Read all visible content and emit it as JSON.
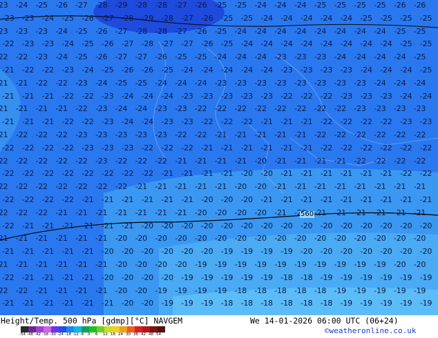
{
  "map": {
    "title": "Height/Temp. 500 hPa [gdmp][°C] NAVGEM",
    "valid_time": "We 14-01-2026 06:00 UTC (06+24)",
    "credit": "©weatheronline.co.uk",
    "contour_labels": [
      "560"
    ],
    "legend": {
      "ticks": [
        "-54",
        "-48",
        "-42",
        "-38",
        "-30",
        "-24",
        "-18",
        "-12",
        "-6",
        "0",
        "6",
        "12",
        "18",
        "24",
        "30",
        "36",
        "42",
        "48",
        "54"
      ],
      "colors": [
        "#2a2a2a",
        "#6a2a8a",
        "#a040d0",
        "#d060f0",
        "#6a38e8",
        "#2050e8",
        "#1888f0",
        "#10b8e8",
        "#10a060",
        "#20c020",
        "#70d020",
        "#c8e020",
        "#f0d020",
        "#f0a020",
        "#e86020",
        "#d82020",
        "#b01818",
        "#801010",
        "#501010"
      ]
    },
    "grid_rows": [
      "-23 -24 -25 -26 -27 -28 -29 -28 -28 -27 -26 -25 -25 -24 -24 -24 -25 -25 -25 -25 -26 -26",
      "-23 -23 -24 -25 -26 -27 -28 -29 -28 -27 -26 -25 -25 -24 -24 -24 -24 -24 -25 -25 -25 -25",
      "-23 -23 -23 -24 -25 -26 -27 -28 -28 -27 -26 -25 -24 -24 -24 -24 -24 -24 -24 -24 -25 -25",
      "-22 -23 -23 -24 -25 -26 -27 -28 -27 -27 -26 -25 -24 -24 -24 -24 -24 -24 -24 -24 -25 -25",
      "-22 -22 -23 -24 -25 -26 -27 -27 -26 -25 -25 -24 -24 -24 -23 -23 -23 -24 -24 -24 -24 -25",
      "-21 -22 -22 -23 -24 -25 -26 -26 -25 -24 -24 -24 -24 -24 -23 -23 -23 -23 -24 -24 -24 -25",
      "-21 -21 -22 -22 -23 -24 -25 -25 -24 -24 -24 -23 -23 -23 -23 -23 -23 -23 -23 -24 -24 -24",
      "-21 -21 -21 -22 -22 -23 -24 -24 -24 -23 -23 -23 -23 -23 -22 -22 -22 -23 -23 -23 -24 -24",
      "-21 -21 -21 -21 -22 -23 -24 -24 -23 -23 -22 -22 -22 -22 -22 -22 -22 -22 -23 -23 -23 -23",
      "-21 -21 -21 -22 -22 -23 -24 -24 -23 -23 -22 -22 -22 -21 -21 -21 -22 -22 -22 -22 -23 -23",
      "-21 -22 -22 -22 -23 -23 -23 -23 -23 -22 -22 -21 -21 -21 -21 -21 -22 -22 -22 -22 -22 -22",
      "-22 -22 -22 -22 -23 -23 -23 -22 -22 -22 -21 -21 -21 -21 -21 -21 -22 -22 -22 -22 -22 -22",
      "-22 -22 -22 -22 -22 -23 -22 -22 -22 -21 -21 -21 -21 -20 -21 -21 -21 -21 -22 -22 -22 -22",
      "-22 -22 -22 -22 -22 -22 -22 -22 -21 -21 -21 -21 -20 -20 -21 -21 -21 -21 -21 -21 -22 -22",
      "-22 -22 -22 -22 -22 -22 -22 -21 -21 -21 -21 -21 -20 -20 -21 -21 -21 -21 -21 -21 -21 -21",
      "-22 -22 -22 -22 -21 -21 -21 -21 -21 -21 -20 -20 -20 -21 -21 -21 -21 -21 -21 -21 -21 -21",
      "-22 -22 -22 -21 -21 -21 -21 -21 -21 -21 -20 -20 -20 -20 -21 -20 -21 -21 -21 -21 -21 -21",
      "-22 -21 -21 -21 -21 -21 -21 -20 -20 -20 -20 -20 -20 -20 -20 -20 -20 -20 -20 -20 -20 -20",
      "-21 -21 -21 -21 -21 -21 -20 -20 -20 -20 -20 -20 -20 -20 -20 -20 -20 -20 -20 -20 -20 -20",
      "-21 -21 -21 -21 -21 -20 -20 -20 -20 -20 -20 -19 -19 -19 -19 -20 -20 -20 -20 -20 -20 -20",
      "-21 -21 -21 -21 -21 -21 -20 -20 -20 -20 -19 -19 -19 -19 -19 -19 -19 -19 -19 -19 -20 -20",
      "-22 -21 -21 -21 -21 -20 -20 -20 -20 -19 -19 -19 -19 -19 -18 -18 -19 -19 -19 -19 -19 -19",
      "-22 -22 -21 -21 -21 -21 -20 -20 -19 -19 -19 -19 -18 -18 -18 -18 -18 -19 -19 -19 -19 -19",
      "-21 -21 -21 -21 -21 -21 -20 -20 -19 -19 -19 -18 -18 -18 -18 -18 -18 -19 -19 -19 -19 -19"
    ]
  }
}
